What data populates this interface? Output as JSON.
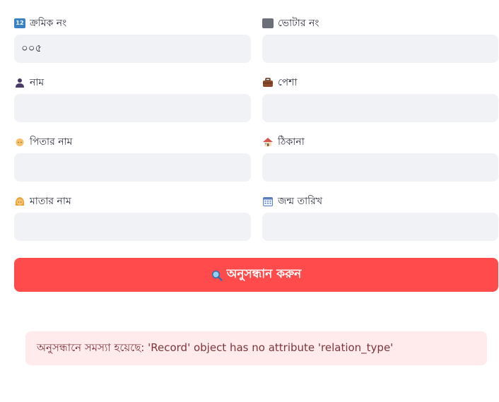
{
  "form": {
    "fields": [
      {
        "label": "ক্রমিক নং",
        "icon": "input-numbers-icon",
        "value": "০০৫",
        "placeholder": ""
      },
      {
        "label": "ভোটার নং",
        "icon": "ballot-box-icon",
        "value": "",
        "placeholder": ""
      },
      {
        "label": "নাম",
        "icon": "person-icon",
        "value": "",
        "placeholder": ""
      },
      {
        "label": "পেশা",
        "icon": "briefcase-icon",
        "value": "",
        "placeholder": ""
      },
      {
        "label": "পিতার নাম",
        "icon": "man-icon",
        "value": "",
        "placeholder": ""
      },
      {
        "label": "ঠিকানা",
        "icon": "house-icon",
        "value": "",
        "placeholder": ""
      },
      {
        "label": "মাতার নাম",
        "icon": "woman-icon",
        "value": "",
        "placeholder": ""
      },
      {
        "label": "জন্ম তারিখ",
        "icon": "calendar-icon",
        "value": "",
        "placeholder": ""
      }
    ]
  },
  "search_button": {
    "label": "অনুসন্ধান করুন",
    "icon": "magnifying-glass-icon",
    "color": "#ff4b4b"
  },
  "error": {
    "message": "অনুসন্ধানে সমস্যা হয়েছে: 'Record' object has no attribute 'relation_type'",
    "background": "#ffebeb",
    "text_color": "#7d353b"
  }
}
